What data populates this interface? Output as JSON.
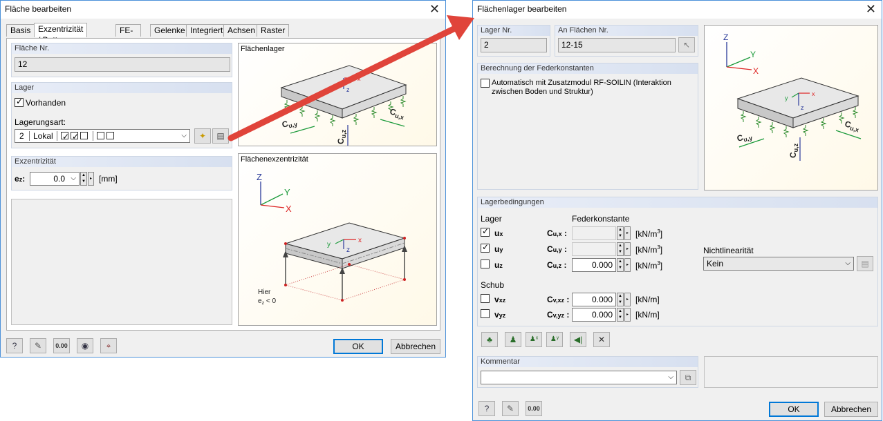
{
  "left": {
    "title": "Fläche bearbeiten",
    "tabs": [
      "Basis",
      "Exzentrizität / Bettung",
      "FE-Netz",
      "Gelenke",
      "Integriert",
      "Achsen",
      "Raster"
    ],
    "flaeche_head": "Fläche Nr.",
    "flaeche_value": "12",
    "lager_head": "Lager",
    "vorhanden": "Vorhanden",
    "lagerungsart_label": "Lagerungsart:",
    "lagerungsart": {
      "nr": "2",
      "typ": "Lokal"
    },
    "exz_head": "Exzentrizität",
    "ez_label": "e",
    "ez_sub": "z",
    "ez_value": "0.0",
    "ez_unit": "[mm]",
    "img1_caption": "Flächenlager",
    "img2_caption": "Flächenexzentrizität",
    "img2_note_1": "Hier",
    "img2_note_2": "e",
    "img2_note_3": "z",
    "img2_note_4": " < 0",
    "ok": "OK",
    "cancel": "Abbrechen"
  },
  "right": {
    "title": "Flächenlager bearbeiten",
    "lager_nr_head": "Lager Nr.",
    "lager_nr_value": "2",
    "an_flaechen_head": "An Flächen Nr.",
    "an_flaechen_value": "12-15",
    "feder_head": "Berechnung der Federkonstanten",
    "feder_text_1": "Automatisch mit Zusatzmodul RF-SOILIN (Interaktion",
    "feder_text_2": "zwischen Boden und Struktur)",
    "bed_head": "Lagerbedingungen",
    "lager_col": "Lager",
    "feder_col": "Federkonstante",
    "rows": [
      {
        "dof": "u",
        "sub": "x",
        "checked": true,
        "c": "C",
        "csub": "u,x",
        "value": "",
        "unit": "[kN/m",
        "exp": "3",
        "close": "]"
      },
      {
        "dof": "u",
        "sub": "y",
        "checked": true,
        "c": "C",
        "csub": "u,y",
        "value": "",
        "unit": "[kN/m",
        "exp": "3",
        "close": "]"
      },
      {
        "dof": "u",
        "sub": "z",
        "checked": false,
        "c": "C",
        "csub": "u,z",
        "value": "0.000",
        "unit": "[kN/m",
        "exp": "3",
        "close": "]"
      }
    ],
    "schub_label": "Schub",
    "schub_rows": [
      {
        "dof": "v",
        "sub": "xz",
        "checked": false,
        "c": "C",
        "csub": "v,xz",
        "value": "0.000",
        "unit": "[kN/m]"
      },
      {
        "dof": "v",
        "sub": "yz",
        "checked": false,
        "c": "C",
        "csub": "v,yz",
        "value": "0.000",
        "unit": "[kN/m]"
      }
    ],
    "nonlin_label": "Nichtlinearität",
    "nonlin_value": "Kein",
    "kommentar_head": "Kommentar",
    "ok": "OK",
    "cancel": "Abbrechen"
  },
  "diagram": {
    "labels": {
      "x": "x",
      "y": "y",
      "z": "z",
      "X": "X",
      "Y": "Y",
      "Z": "Z",
      "cux": "C",
      "cux_sub": "u,x",
      "cuy": "C",
      "cuy_sub": "u,y",
      "cuz": "C",
      "cuz_sub": "u,z"
    }
  },
  "colors": {
    "arrow": "#e0443a",
    "accent": "#0078d7",
    "axis_x": "#d22",
    "axis_y": "#1a9a3a",
    "axis_z": "#2a3a9a"
  }
}
